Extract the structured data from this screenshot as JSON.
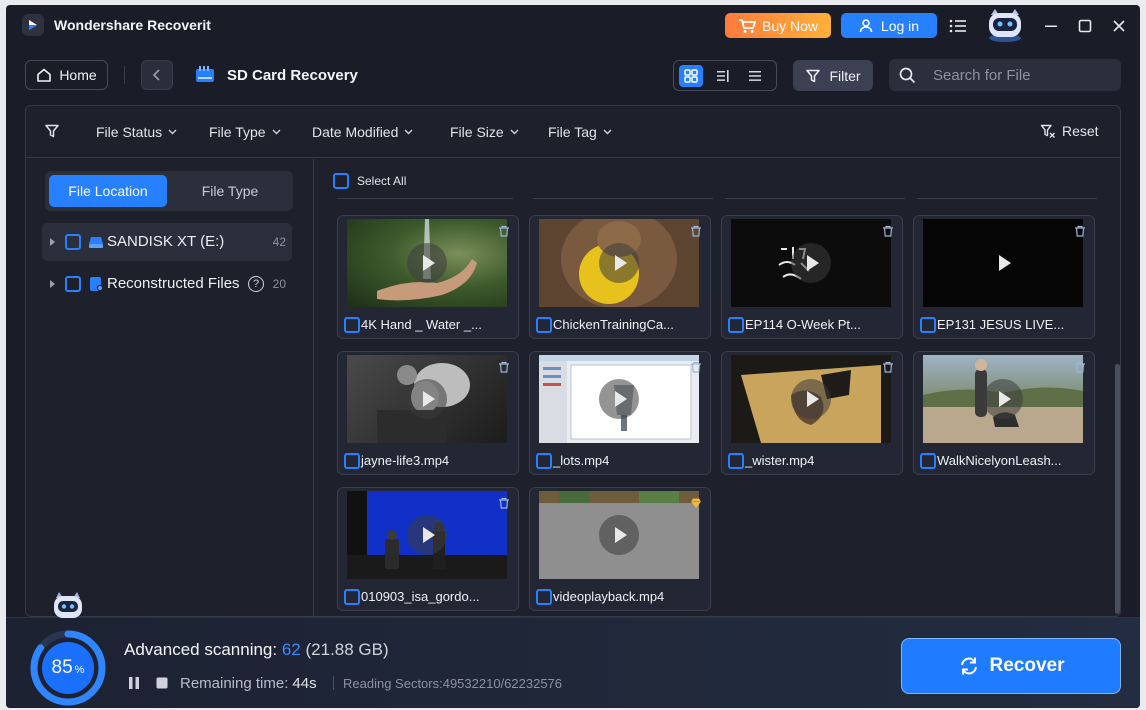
{
  "app": {
    "title": "Wondershare Recoverit"
  },
  "titlebar": {
    "buy_now": "Buy Now",
    "log_in": "Log in"
  },
  "toolbar": {
    "home": "Home",
    "page_title": "SD Card Recovery",
    "filter": "Filter",
    "search_placeholder": "Search for File",
    "active_view": "grid"
  },
  "filters": {
    "items": [
      "File Status",
      "File Type",
      "Date Modified",
      "File Size",
      "File Tag"
    ],
    "reset": "Reset"
  },
  "sidebar": {
    "tabs": [
      "File Location",
      "File Type"
    ],
    "active_tab": "File Location",
    "tree": [
      {
        "label": "SANDISK XT (E:)",
        "count": "42",
        "icon": "drive-icon"
      },
      {
        "label": "Reconstructed Files",
        "count": "20",
        "icon": "reconstructed-icon"
      }
    ]
  },
  "content": {
    "select_all": "Select All",
    "files": [
      {
        "name": "4K Hand _ Water _...",
        "thumb": "water-hand"
      },
      {
        "name": "ChickenTrainingCa...",
        "thumb": "chicken"
      },
      {
        "name": "EP114 O-Week Pt...",
        "thumb": "black-text"
      },
      {
        "name": "EP131 JESUS LIVE...",
        "thumb": "black"
      },
      {
        "name": "jayne-life3.mp4",
        "thumb": "bw-portrait"
      },
      {
        "name": "_lots.mp4",
        "thumb": "software"
      },
      {
        "name": "_wister.mp4",
        "thumb": "table-hands"
      },
      {
        "name": "WalkNicelyonLeash...",
        "thumb": "dog-walk"
      },
      {
        "name": "010903_isa_gordo...",
        "thumb": "stage-blue"
      },
      {
        "name": "videoplayback.mp4",
        "thumb": "grey"
      }
    ]
  },
  "scan": {
    "progress_percent": 85,
    "label": "Advanced scanning:",
    "count": "62",
    "size": "(21.88 GB)",
    "remaining_label": "Remaining time:",
    "remaining_value": "44s",
    "sectors": "Reading Sectors:49532210/62232576"
  },
  "recover_button": "Recover",
  "colors": {
    "accent": "#2680ff",
    "buy": "#ff8a3c",
    "background": "#1a1d27"
  }
}
